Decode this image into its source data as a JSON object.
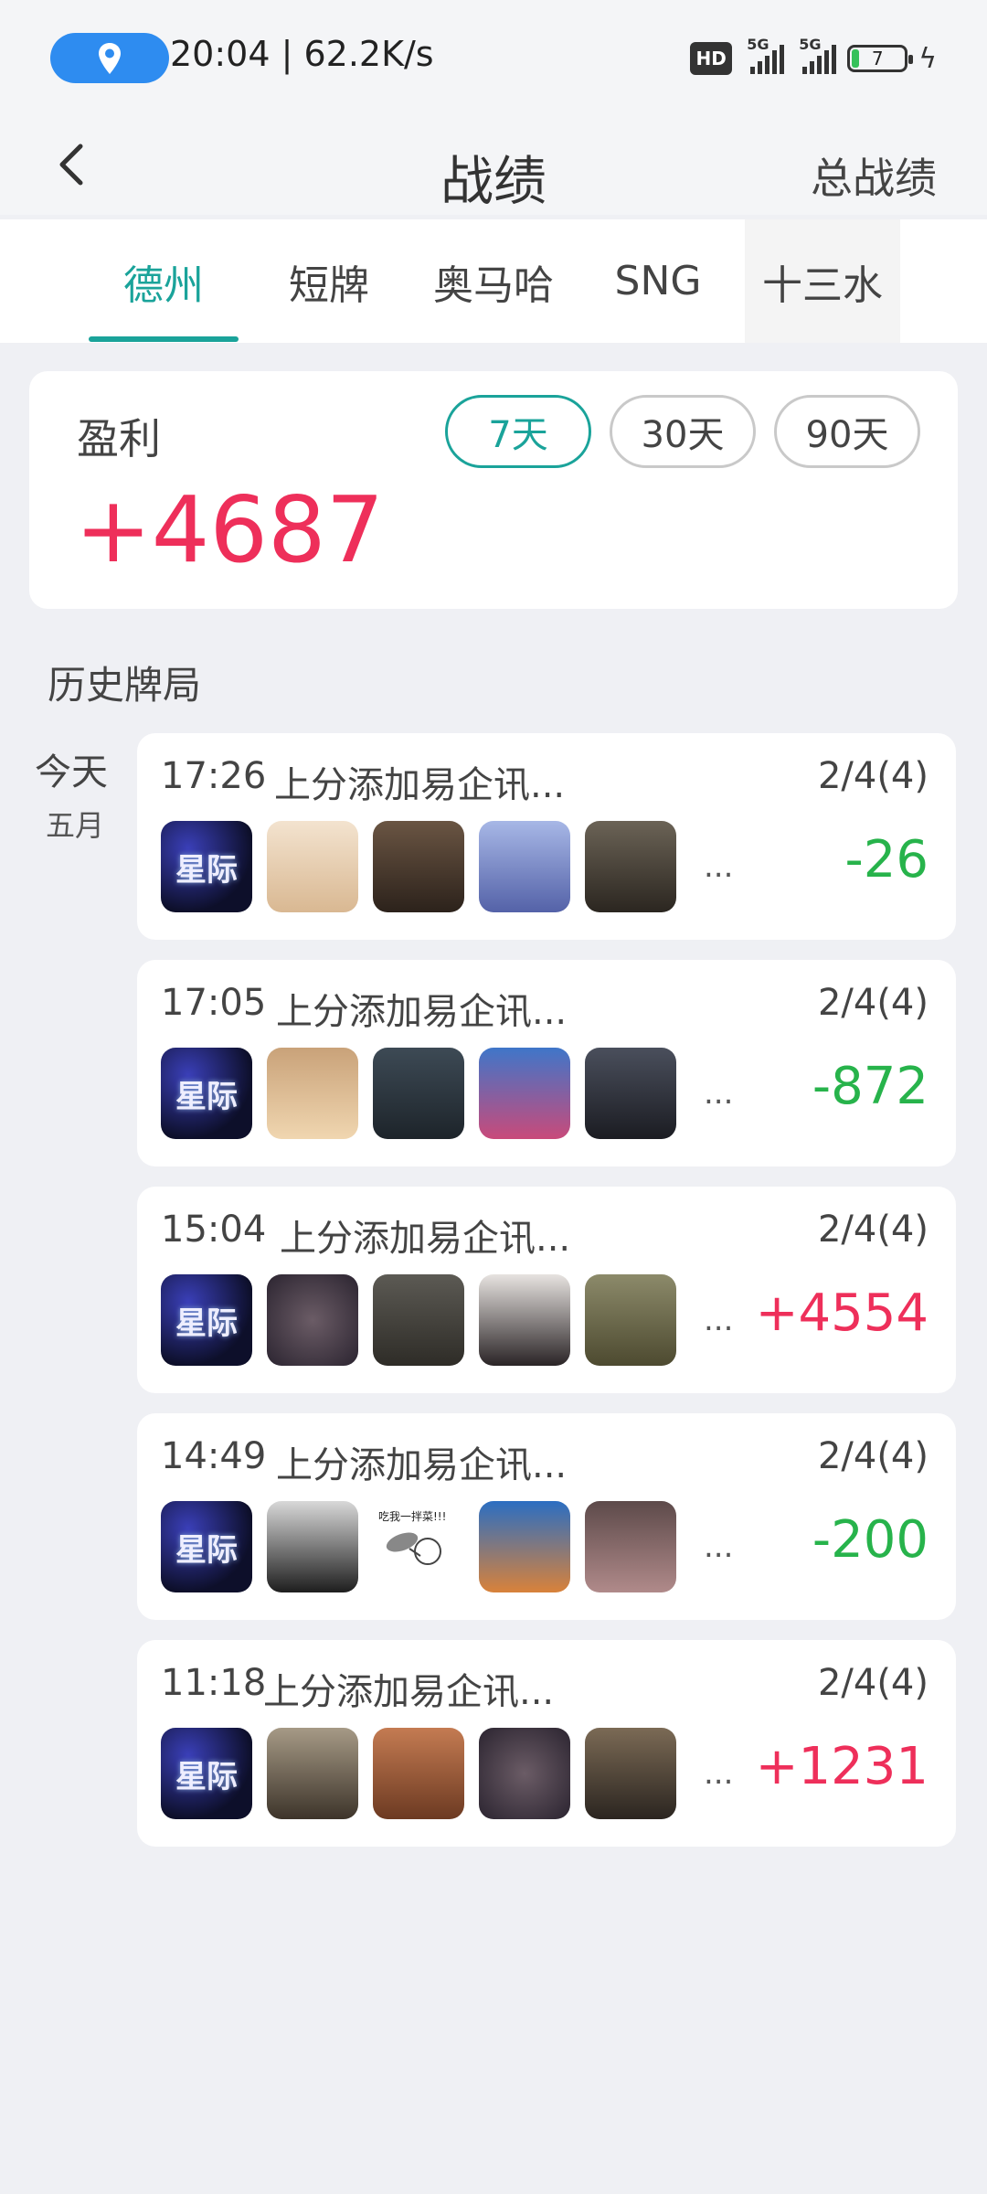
{
  "status_bar": {
    "time_speed": "20:04 | 62.2K/s",
    "hd_label": "HD",
    "net1": "5G",
    "net2": "5G",
    "battery": "7",
    "charging_icon": "bolt-icon",
    "location_icon": "location-pin-icon"
  },
  "nav": {
    "back_icon": "chevron-left-icon",
    "title": "战绩",
    "total_link": "总战绩"
  },
  "tabs": [
    {
      "label": "德州",
      "active": true
    },
    {
      "label": "短牌",
      "active": false
    },
    {
      "label": "奥马哈",
      "active": false
    },
    {
      "label": "SNG",
      "active": false
    },
    {
      "label": "十三水",
      "active": false
    }
  ],
  "profit": {
    "label": "盈利",
    "value": "+4687",
    "ranges": [
      {
        "label": "7天",
        "active": true
      },
      {
        "label": "30天",
        "active": false
      },
      {
        "label": "90天",
        "active": false
      }
    ]
  },
  "history": {
    "title": "历史牌局",
    "date_day": "今天",
    "date_month": "五月",
    "games": [
      {
        "time": "17:26",
        "name": "上分添加易企讯...",
        "count": "2/4(4)",
        "result": "-26",
        "type": "neg"
      },
      {
        "time": "17:05",
        "name": "上分添加易企讯...",
        "count": "2/4(4)",
        "result": "-872",
        "type": "neg"
      },
      {
        "time": "15:04",
        "name": "上分添加易企讯...",
        "count": "2/4(4)",
        "result": "+4554",
        "type": "pos"
      },
      {
        "time": "14:49",
        "name": "上分添加易企讯...",
        "count": "2/4(4)",
        "result": "-200",
        "type": "neg"
      },
      {
        "time": "11:18",
        "name": "上分添加易企讯...",
        "count": "2/4(4)",
        "result": "+1231",
        "type": "pos"
      }
    ],
    "avatar_star_text": "星际",
    "avatar_more": "...",
    "meme_text": "吃我一拌菜!!!"
  },
  "colors": {
    "accent": "#1aa39a",
    "positive": "#ee2f5a",
    "negative": "#27b34b",
    "background": "#eff0f4"
  }
}
